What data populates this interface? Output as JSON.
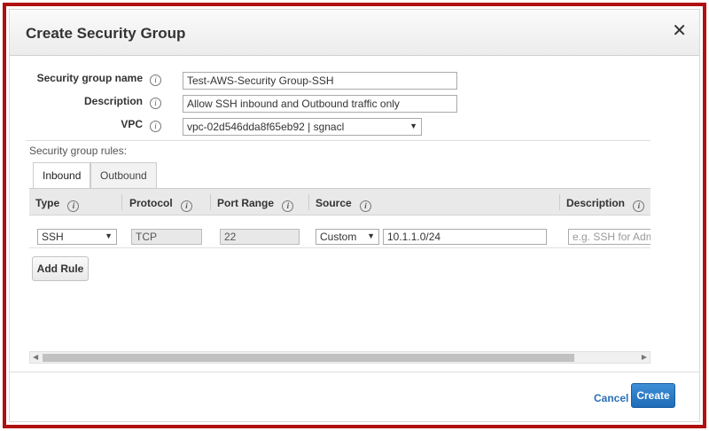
{
  "dialog": {
    "title": "Create Security Group",
    "close_glyph": "✕"
  },
  "form": {
    "name_label": "Security group name",
    "name_value": "Test-AWS-Security Group-SSH",
    "description_label": "Description",
    "description_value": "Allow SSH inbound and Outbound traffic only",
    "vpc_label": "VPC",
    "vpc_value": "vpc-02d546dda8f65eb92 | sgnacl"
  },
  "rules": {
    "section_label": "Security group rules:",
    "tabs": [
      "Inbound",
      "Outbound"
    ],
    "active_tab": "Inbound",
    "columns": [
      "Type",
      "Protocol",
      "Port Range",
      "Source",
      "Description"
    ],
    "row": {
      "type": "SSH",
      "protocol": "TCP",
      "port_range": "22",
      "source_type": "Custom",
      "source_value": "10.1.1.0/24",
      "description_placeholder": "e.g. SSH for Admin D"
    },
    "add_rule_label": "Add Rule"
  },
  "footer": {
    "cancel_label": "Cancel",
    "create_label": "Create"
  },
  "icons": {
    "info": "i",
    "caret": "▼",
    "scroll_left": "◀",
    "scroll_right": "▶"
  },
  "colors": {
    "frame_border": "#b01010",
    "primary_button": "#1f6bb8",
    "link": "#2a6fb5"
  }
}
